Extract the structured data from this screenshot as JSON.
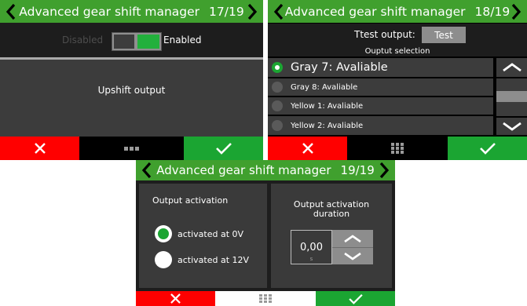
{
  "colors": {
    "header_green": "#40a02e",
    "cancel_red": "#ff0000",
    "ok_green": "#1ba532",
    "panel_bg": "#1d1d1d",
    "row_bg": "#3c3c3c"
  },
  "screen1": {
    "title": "Advanced gear shift manager",
    "page": "17/19",
    "toggle": {
      "off_label": "Disabled",
      "on_label": "Enabled",
      "state": "enabled"
    },
    "item_label": "Upshift output"
  },
  "screen2": {
    "title": "Advanced gear shift manager",
    "page": "18/19",
    "test_label": "Ttest output:",
    "test_button": "Test",
    "section_title": "Ouptut selection",
    "options": [
      {
        "label": "Gray 7: Avaliable",
        "selected": true
      },
      {
        "label": "Gray 8: Avaliable",
        "selected": false
      },
      {
        "label": "Yellow 1: Avaliable",
        "selected": false
      },
      {
        "label": "Yellow 2: Avaliable",
        "selected": false
      }
    ]
  },
  "screen3": {
    "title": "Advanced gear shift manager",
    "page": "19/19",
    "activation_title": "Output activation",
    "radio_options": [
      {
        "label": "activated at 0V",
        "selected": true
      },
      {
        "label": "activated at 12V",
        "selected": false
      }
    ],
    "duration_title": "Output activation duration",
    "duration_value": "0,00",
    "duration_unit": "s"
  },
  "icons": {
    "prev": "chevron-left-icon",
    "next": "chevron-right-icon",
    "cancel": "close-icon",
    "confirm": "check-icon",
    "menu": "grid-icon",
    "up": "chevron-up-icon",
    "down": "chevron-down-icon"
  }
}
